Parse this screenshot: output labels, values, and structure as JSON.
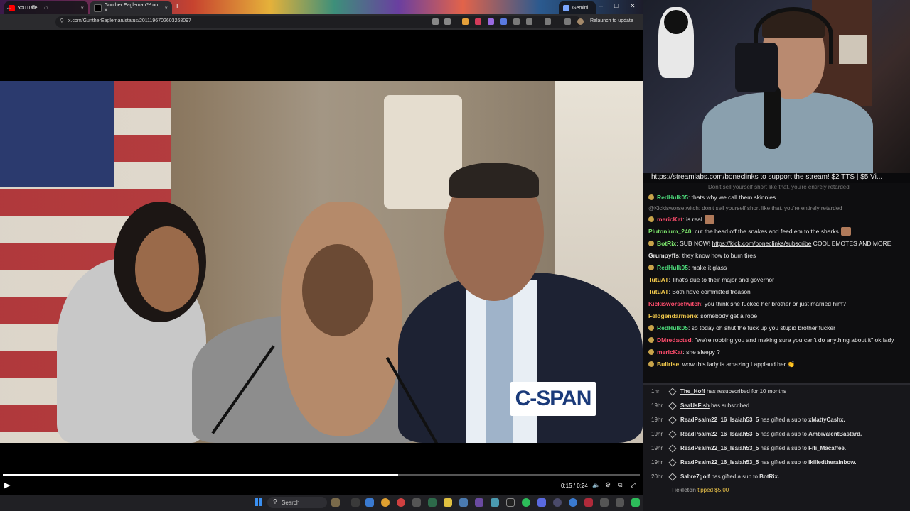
{
  "browser": {
    "tabs": [
      {
        "title": "YouTube"
      },
      {
        "title": "Gunther Eagleman™ on X:"
      },
      {
        "title": "Gemini"
      }
    ],
    "new_tab": "+",
    "url": "x.com/GuntherEagleman/status/2011196702603268097",
    "relaunch": "Relaunch to update"
  },
  "video": {
    "watermark": "C-SPAN",
    "time": "0:15 / 0:24",
    "progress": 0.62
  },
  "stream": {
    "banner_link": "https://streamlabs.com/boneclinks",
    "banner_text": " to support the stream! $2 TTS | $5 Vi..."
  },
  "chat": {
    "ghost": "Don't sell yourself short like that. you're entirely retarded",
    "colors": {
      "green": "#4cd97a",
      "pink": "#ff4d6d",
      "teal": "#44c2b0",
      "yellow": "#f1c84b",
      "lime": "#7be36b",
      "white": "#e8e8e8"
    },
    "messages": [
      {
        "user": "RedHulk05",
        "color": "green",
        "text": "thats why we call them skinnies",
        "badge": true
      },
      {
        "reply": "@Kickisworsetwitch: don't sell yourself short like that. you're entirely retarded"
      },
      {
        "user": "mericKat",
        "color": "pink",
        "text": "is real",
        "badge": true,
        "emote": true
      },
      {
        "user": "Plutonium_240",
        "color": "lime",
        "text": "cut the head off the snakes and feed em to the sharks",
        "emote": true
      },
      {
        "user": "BotRix",
        "color": "lime",
        "text": "SUB NOW! ",
        "link": "https://kick.com/boneclinks/subscribe",
        "tail": " COOL EMOTES AND MORE!",
        "badge": true
      },
      {
        "user": "Grumpyffs",
        "color": "white",
        "text": "they know how to burn tires"
      },
      {
        "user": "RedHulk05",
        "color": "green",
        "text": "make it glass",
        "badge": true
      },
      {
        "user": "TutuAT",
        "color": "yellow",
        "text": "That's due to their major and governor"
      },
      {
        "user": "TutuAT",
        "color": "yellow",
        "text": "Both have committed treason"
      },
      {
        "user": "Kickisworsetwitch",
        "color": "pink",
        "text": "you think she fucked her brother or just married him?"
      },
      {
        "user": "Feldgendarmerie",
        "color": "yellow",
        "text": "somebody get a rope"
      },
      {
        "user": "RedHulk05",
        "color": "green",
        "text": "so today oh shut the fuck up you stupid brother fucker",
        "badge": true
      },
      {
        "user": "DMredacted",
        "color": "pink",
        "text": "\"we're robbing you and making sure you can't do anything about it\" ok lady",
        "badge": true
      },
      {
        "user": "mericKat",
        "color": "pink",
        "text": "she sleepy ?",
        "badge": true
      },
      {
        "user": "Bullrise",
        "color": "yellow",
        "text": "wow this lady is amazing I applaud her 👏",
        "badge": true
      }
    ]
  },
  "events": [
    {
      "time": "1hr",
      "user": "The_Hoff",
      "underline": true,
      "text": " has resubscribed for 10 months"
    },
    {
      "time": "19hr",
      "user": "SeaUsFish",
      "underline": true,
      "text": " has subscribed"
    },
    {
      "time": "19hr",
      "user": "ReadPsalm22_16_Isaiah53_5",
      "text": " has gifted a sub to ",
      "target": "xMattyCashx."
    },
    {
      "time": "19hr",
      "user": "ReadPsalm22_16_Isaiah53_5",
      "text": " has gifted a sub to ",
      "target": "AmbivalentBastard."
    },
    {
      "time": "19hr",
      "user": "ReadPsalm22_16_Isaiah53_5",
      "text": " has gifted a sub to ",
      "target": "Fifi_Macaffee."
    },
    {
      "time": "19hr",
      "user": "ReadPsalm22_16_Isaiah53_5",
      "text": " has gifted a sub to ",
      "target": "ikilledtherainbow."
    },
    {
      "time": "20hr",
      "user": "Sabre7golf",
      "text": " has gifted a sub to ",
      "target": "BotRix."
    }
  ],
  "tip": {
    "user": "Tickleton",
    "amount": "tipped $5.00"
  },
  "taskbar": {
    "search": "Search"
  }
}
